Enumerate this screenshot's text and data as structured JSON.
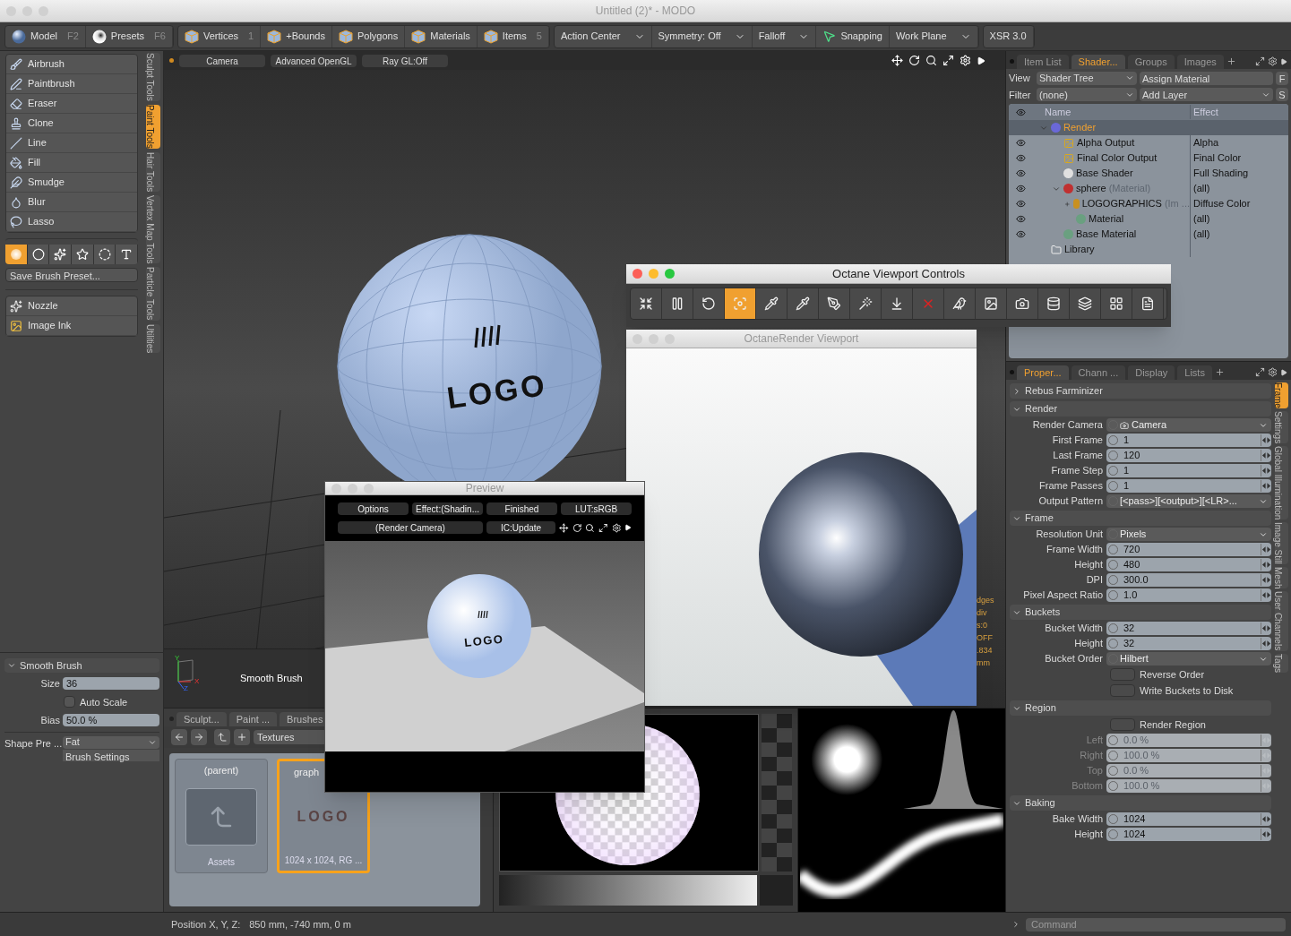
{
  "window": {
    "title": "Untitled (2)* - MODO"
  },
  "toolbar": [
    {
      "items": [
        {
          "kind": "sphere",
          "label": "Model",
          "shortcut": "F2"
        },
        {
          "kind": "ball",
          "label": "Presets",
          "shortcut": "F6"
        }
      ]
    },
    {
      "items": [
        {
          "kind": "cube",
          "label": "Vertices",
          "shortcut": "1"
        },
        {
          "kind": "cube",
          "label": "+Bounds"
        },
        {
          "kind": "cube",
          "label": "Polygons"
        },
        {
          "kind": "cube",
          "label": "Materials"
        },
        {
          "kind": "cube",
          "label": "Items",
          "shortcut": "5"
        }
      ]
    },
    {
      "items": [
        {
          "kind": "dropdown",
          "label": "Action Center"
        },
        {
          "kind": "dropdown",
          "label": "Symmetry: Off"
        },
        {
          "kind": "dropdown",
          "label": "Falloff"
        },
        {
          "kind": "snap",
          "label": "Snapping"
        },
        {
          "kind": "dropdown",
          "label": "Work Plane"
        }
      ]
    },
    {
      "items": [
        {
          "kind": "plain",
          "label": "XSR 3.0"
        }
      ]
    }
  ],
  "left_panel": {
    "tools": [
      {
        "label": "Airbrush"
      },
      {
        "label": "Paintbrush"
      },
      {
        "label": "Eraser"
      },
      {
        "label": "Clone"
      },
      {
        "label": "Line"
      },
      {
        "label": "Fill"
      },
      {
        "label": "Smudge"
      },
      {
        "label": "Blur"
      },
      {
        "label": "Lasso"
      }
    ],
    "brush_shapes": [
      {
        "selected": true
      },
      {
        "selected": false
      },
      {
        "selected": false
      },
      {
        "selected": false
      },
      {
        "selected": false
      },
      {
        "selected": false
      }
    ],
    "save_preset": "Save Brush Preset...",
    "ink_tools": [
      {
        "label": "Nozzle"
      },
      {
        "label": "Image Ink"
      }
    ],
    "side_tabs": [
      {
        "label": "Sculpt Tools",
        "selected": false
      },
      {
        "label": "Paint Tools",
        "selected": true
      },
      {
        "label": "Hair Tools",
        "selected": false
      },
      {
        "label": "Vertex Map Tools",
        "selected": false
      },
      {
        "label": "Particle Tools",
        "selected": false
      },
      {
        "label": "Utilities",
        "selected": false
      }
    ],
    "brush_section": {
      "title": "Smooth Brush",
      "expanded": true,
      "size_label": "Size",
      "size": "36",
      "auto_scale": {
        "label": "Auto Scale",
        "checked": false
      },
      "bias_label": "Bias",
      "bias": "50.0 %"
    },
    "shape_preset": {
      "label": "Shape Pre ...",
      "value": "Fat",
      "settings": "Brush Settings"
    }
  },
  "viewport": {
    "header": [
      "Camera",
      "Advanced OpenGL",
      "Ray GL:Off"
    ],
    "sphere_label": "LOGO",
    "axes": [
      "Y",
      "X",
      "Z"
    ],
    "brush_label": "Smooth Brush",
    "info": [
      "dges",
      "div",
      "s:0",
      "OFF",
      ".834",
      "mm"
    ]
  },
  "asset_browser": {
    "tabs": [
      "Sculpt...",
      "Paint ...",
      "Brushes"
    ],
    "path": "Textures",
    "tiles": [
      {
        "kind": "folder",
        "title": "(parent)",
        "caption": "Assets",
        "selected": false
      },
      {
        "kind": "image",
        "title": "graph",
        "caption": "1024 x 1024, RG ...",
        "image_text": "LOGO",
        "selected": true
      }
    ]
  },
  "shader_panel": {
    "tabs": [
      {
        "label": "Item List",
        "selected": false
      },
      {
        "label": "Shader...",
        "selected": true
      },
      {
        "label": "Groups",
        "selected": false
      },
      {
        "label": "Images",
        "selected": false
      }
    ],
    "view_label": "View",
    "view": "Shader Tree",
    "assign": "Assign Material",
    "f": "F",
    "filter_label": "Filter",
    "filter": "(none)",
    "add_layer": "Add Layer",
    "s": "S",
    "columns": [
      "Name",
      "Effect"
    ],
    "tree": [
      {
        "kind": "render",
        "name": "Render",
        "visible": false,
        "selected": true,
        "expanded": true,
        "children": [
          {
            "kind": "output",
            "name": "Alpha Output",
            "effect": "Alpha",
            "visible": true,
            "selected": false
          },
          {
            "kind": "output",
            "name": "Final Color Output",
            "effect": "Final Color",
            "visible": true,
            "selected": false
          },
          {
            "kind": "shader",
            "name": "Base Shader",
            "effect": "Full Shading",
            "visible": true,
            "selected": false
          },
          {
            "kind": "mask",
            "name": "sphere",
            "note": "(Material)",
            "effect": "(all)",
            "visible": true,
            "selected": false,
            "expanded": true,
            "children": [
              {
                "kind": "image",
                "name": "LOGOGRAPHICS",
                "note": "(Im ...",
                "effect": "Diffuse Color",
                "visible": true,
                "selected": false,
                "expanded": false
              },
              {
                "kind": "material",
                "name": "Material",
                "effect": "(all)",
                "visible": true,
                "selected": false
              }
            ]
          },
          {
            "kind": "material",
            "name": "Base Material",
            "effect": "(all)",
            "visible": true,
            "selected": false
          }
        ]
      },
      {
        "kind": "folder",
        "name": "Library",
        "visible": false,
        "selected": false
      }
    ]
  },
  "properties": {
    "tabs": [
      {
        "label": "Proper...",
        "selected": true
      },
      {
        "label": "Chann ...",
        "selected": false
      },
      {
        "label": "Display",
        "selected": false
      },
      {
        "label": "Lists",
        "selected": false
      }
    ],
    "sections": [
      {
        "title": "Rebus Farminizer",
        "expanded": false
      },
      {
        "title": "Render",
        "expanded": true,
        "rows": [
          {
            "kind": "camera",
            "label": "Render Camera",
            "value": "Camera",
            "disabled": false
          },
          {
            "kind": "number",
            "label": "First Frame",
            "value": "1",
            "disabled": false
          },
          {
            "kind": "number",
            "label": "Last Frame",
            "value": "120",
            "disabled": false
          },
          {
            "kind": "number",
            "label": "Frame Step",
            "value": "1",
            "disabled": false
          },
          {
            "kind": "number",
            "label": "Frame Passes",
            "value": "1",
            "disabled": false
          },
          {
            "kind": "dropdown",
            "label": "Output Pattern",
            "value": "[<pass>][<output>][<LR>...",
            "disabled": false
          }
        ]
      },
      {
        "title": "Frame",
        "expanded": true,
        "rows": [
          {
            "kind": "dropdown",
            "label": "Resolution Unit",
            "value": "Pixels",
            "disabled": false
          },
          {
            "kind": "number",
            "label": "Frame Width",
            "value": "720",
            "disabled": false
          },
          {
            "kind": "number",
            "label": "Height",
            "value": "480",
            "disabled": false
          },
          {
            "kind": "number",
            "label": "DPI",
            "value": "300.0",
            "disabled": false
          },
          {
            "kind": "number",
            "label": "Pixel Aspect Ratio",
            "value": "1.0",
            "disabled": false
          }
        ]
      },
      {
        "title": "Buckets",
        "expanded": true,
        "rows": [
          {
            "kind": "number",
            "label": "Bucket Width",
            "value": "32",
            "disabled": false
          },
          {
            "kind": "number",
            "label": "Height",
            "value": "32",
            "disabled": false
          },
          {
            "kind": "dropdown",
            "label": "Bucket Order",
            "value": "Hilbert",
            "disabled": false
          },
          {
            "kind": "toggle",
            "label": "Reverse Order",
            "checked": false,
            "disabled": false
          },
          {
            "kind": "toggle",
            "label": "Write Buckets to Disk",
            "checked": false,
            "disabled": false
          }
        ]
      },
      {
        "title": "Region",
        "expanded": true,
        "rows": [
          {
            "kind": "toggle",
            "label": "Render Region",
            "checked": false,
            "disabled": false
          },
          {
            "kind": "number",
            "label": "Left",
            "value": "0.0 %",
            "disabled": true
          },
          {
            "kind": "number",
            "label": "Right",
            "value": "100.0 %",
            "disabled": true
          },
          {
            "kind": "number",
            "label": "Top",
            "value": "0.0 %",
            "disabled": true
          },
          {
            "kind": "number",
            "label": "Bottom",
            "value": "100.0 %",
            "disabled": true
          }
        ]
      },
      {
        "title": "Baking",
        "expanded": true,
        "rows": [
          {
            "kind": "number",
            "label": "Bake Width",
            "value": "1024",
            "disabled": false
          },
          {
            "kind": "number",
            "label": "Height",
            "value": "1024",
            "disabled": false
          }
        ]
      }
    ],
    "side_tabs": [
      {
        "label": "Frame",
        "selected": true
      },
      {
        "label": "Settings",
        "selected": false
      },
      {
        "label": "Global Illumination",
        "selected": false
      },
      {
        "label": "Image Still",
        "selected": false
      },
      {
        "label": "Mesh",
        "selected": false
      },
      {
        "label": "User Channels",
        "selected": false
      },
      {
        "label": "Tags",
        "selected": false
      }
    ]
  },
  "octane_controls": {
    "title": "Octane Viewport Controls",
    "tools": [
      {
        "selected": false
      },
      {
        "selected": false
      },
      {
        "selected": false
      },
      {
        "selected": true
      },
      {
        "selected": false
      },
      {
        "selected": false
      },
      {
        "selected": false
      },
      {
        "selected": false
      },
      {
        "selected": false
      },
      {
        "selected": false
      },
      {
        "selected": false
      },
      {
        "selected": false
      },
      {
        "selected": false
      },
      {
        "selected": false
      },
      {
        "selected": false
      },
      {
        "selected": false
      },
      {
        "selected": false
      }
    ]
  },
  "octane_viewport": {
    "title": "OctaneRender Viewport"
  },
  "preview": {
    "title": "Preview",
    "buttons": [
      "Options",
      "Effect:(Shadin...",
      "Finished",
      "LUT:sRGB",
      "(Render Camera)",
      "IC:Update"
    ],
    "image_text": "LOGO"
  },
  "status_bar": {
    "label": "Position X, Y, Z:",
    "value": "850 mm, -740 mm, 0 m"
  },
  "command": {
    "placeholder": "Command"
  }
}
